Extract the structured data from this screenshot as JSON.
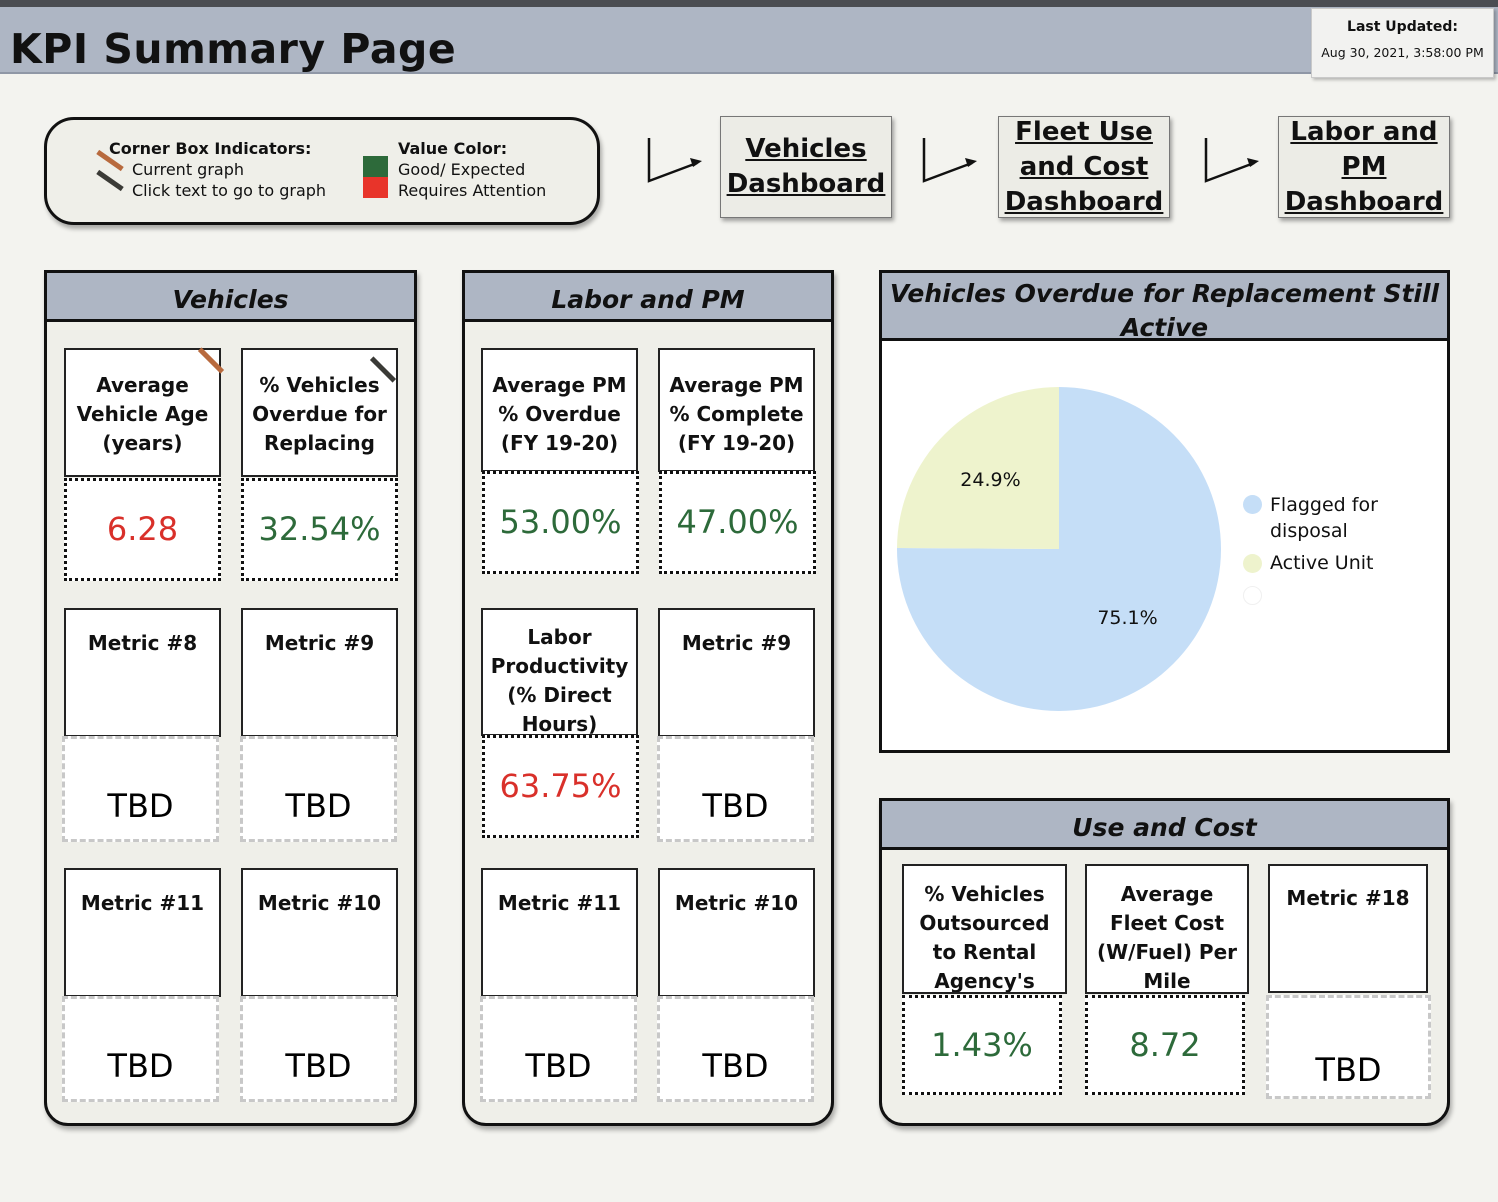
{
  "header": {
    "title": "KPI Summary Page",
    "last_updated_label": "Last Updated:",
    "last_updated_value": "Aug 30, 2021, 3:58:00 PM"
  },
  "legend": {
    "corner_title": "Corner Box Indicators:",
    "current_graph": "Current graph",
    "click_text": "Click text to go to graph",
    "value_title": "Value Color:",
    "good": "Good/ Expected",
    "attention": "Requires Attention",
    "colors": {
      "current": "#b86a3e",
      "link": "#3a3a36",
      "good": "#2d6a3a",
      "attention": "#e8342a"
    }
  },
  "nav": {
    "vehicles": [
      "Vehicles",
      "Dashboard"
    ],
    "fleet": [
      "Fleet Use",
      "and Cost",
      "Dashboard"
    ],
    "labor": [
      "Labor and",
      "PM",
      "Dashboard"
    ]
  },
  "vehicles": {
    "title": "Vehicles",
    "tiles": [
      {
        "label": [
          "Average",
          "Vehicle Age",
          "(years)"
        ],
        "value": "6.28",
        "status": "bad"
      },
      {
        "label": [
          "% Vehicles",
          "Overdue for",
          "Replacing"
        ],
        "value": "32.54%",
        "status": "good"
      },
      {
        "label": [
          "Metric #8"
        ],
        "value": "TBD"
      },
      {
        "label": [
          "Metric #9"
        ],
        "value": "TBD"
      },
      {
        "label": [
          "Metric #11"
        ],
        "value": "TBD"
      },
      {
        "label": [
          "Metric #10"
        ],
        "value": "TBD"
      }
    ]
  },
  "labor": {
    "title": "Labor and PM",
    "tiles": [
      {
        "label": [
          "Average PM",
          "% Overdue",
          "(FY 19-20)"
        ],
        "value": "53.00%",
        "status": "good"
      },
      {
        "label": [
          "Average PM",
          "% Complete",
          "(FY 19-20)"
        ],
        "value": "47.00%",
        "status": "good"
      },
      {
        "label": [
          "Labor",
          "Productivity",
          "(% Direct",
          "Hours)"
        ],
        "value": "63.75%",
        "status": "bad"
      },
      {
        "label": [
          "Metric #9"
        ],
        "value": "TBD"
      },
      {
        "label": [
          "Metric #11"
        ],
        "value": "TBD"
      },
      {
        "label": [
          "Metric #10"
        ],
        "value": "TBD"
      }
    ]
  },
  "use_cost": {
    "title": "Use and Cost",
    "tiles": [
      {
        "label": [
          "% Vehicles",
          "Outsourced",
          "to Rental",
          "Agency's"
        ],
        "value": "1.43%",
        "status": "good"
      },
      {
        "label": [
          "Average",
          "Fleet Cost",
          "(W/Fuel) Per",
          "Mile"
        ],
        "value": "8.72",
        "status": "good"
      },
      {
        "label": [
          "Metric #18"
        ],
        "value": "TBD"
      }
    ]
  },
  "pie": {
    "title_lines": [
      "Vehicles Overdue for Replacement Still",
      "Active"
    ],
    "legend": [
      "Flagged for",
      "disposal",
      "Active Unit"
    ]
  },
  "chart_data": {
    "type": "pie",
    "title": "Vehicles Overdue for Replacement Still Active",
    "labels": [
      "Flagged for disposal",
      "Active Unit"
    ],
    "values": [
      75.1,
      24.9
    ],
    "value_labels": [
      "75.1%",
      "24.9%"
    ],
    "colors": [
      "#c5def7",
      "#eef3cd"
    ],
    "legend_position": "right"
  }
}
